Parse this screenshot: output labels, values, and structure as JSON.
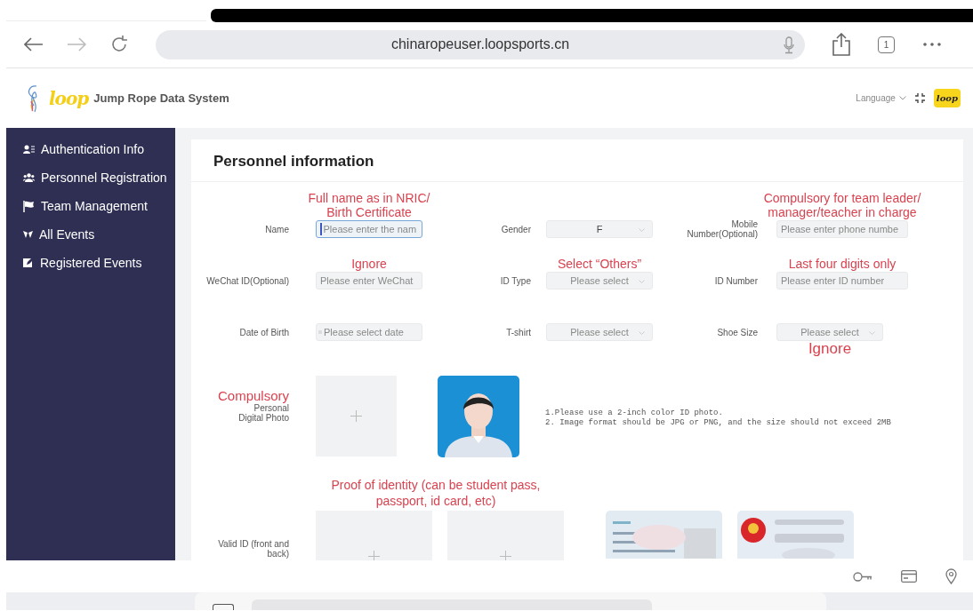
{
  "browser": {
    "url": "chinaropeuser.loopsports.cn",
    "tab_count": "1"
  },
  "header": {
    "logo_text": "loop",
    "title": "Jump Rope Data System",
    "language": "Language",
    "avatar_text": "loop"
  },
  "sidebar": {
    "items": [
      {
        "label": "Authentication Info",
        "selected": false
      },
      {
        "label": "Personnel Registration",
        "selected": false
      },
      {
        "label": "Team Management",
        "selected": false
      },
      {
        "label": "All Events",
        "selected": false
      },
      {
        "label": "Registered Events",
        "selected": false
      }
    ]
  },
  "card": {
    "title": "Personnel information",
    "rows": [
      [
        {
          "label": "Name",
          "kind": "input",
          "placeholder": "Please enter the nam",
          "focused": true,
          "note": "Full name as in NRIC/ Birth Certificate"
        },
        {
          "label": "Gender",
          "kind": "select",
          "value": "F",
          "focused": false
        },
        {
          "label": "Mobile Number(Optional)",
          "kind": "input",
          "placeholder": "Please enter phone numbe",
          "focused": false,
          "note": "Compulsory for team leader/ manager/teacher in charge"
        }
      ],
      [
        {
          "label": "WeChat ID(Optional)",
          "kind": "input",
          "placeholder": "Please enter WeChat",
          "focused": false,
          "note": "Ignore"
        },
        {
          "label": "ID Type",
          "kind": "select",
          "placeholder": "Please select",
          "focused": false,
          "note": "Select “Others”"
        },
        {
          "label": "ID Number",
          "kind": "input",
          "placeholder": "Please enter ID number",
          "focused": false,
          "note": "Last four digits only"
        }
      ],
      [
        {
          "label": "Date of Birth",
          "kind": "date",
          "placeholder": "Please select date",
          "focused": false
        },
        {
          "label": "T-shirt",
          "kind": "select",
          "placeholder": "Please select",
          "focused": false
        },
        {
          "label": "Shoe Size",
          "kind": "select",
          "placeholder": "Please select",
          "focused": false,
          "note": "Ignore"
        }
      ]
    ],
    "photo": {
      "note": "Compulsory",
      "label": "Personal Digital Photo",
      "instructions": [
        "1.Please use a 2-inch color ID photo.",
        "2. Image format should be JPG or PNG, and the size should not exceed 2MB"
      ]
    },
    "valid_id": {
      "note": "Proof of identity (can be student pass, passport, id card, etc)",
      "label": "Valid ID (front and back)"
    }
  }
}
